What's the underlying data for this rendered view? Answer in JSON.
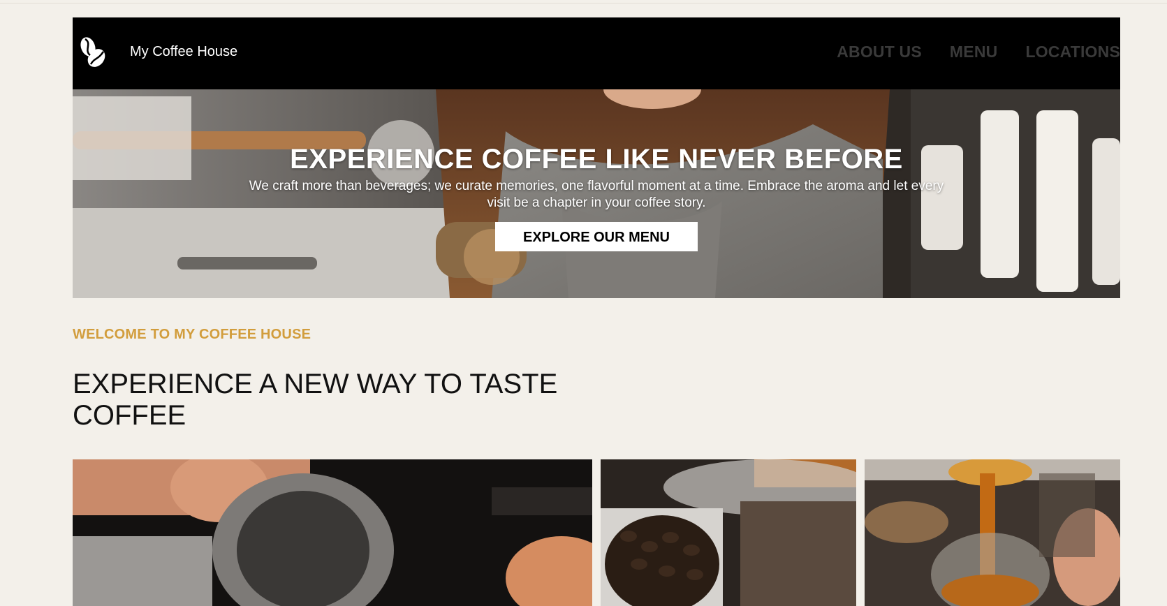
{
  "header": {
    "brand": "My Coffee House",
    "logo_icon": "coffee-beans-icon",
    "nav": [
      {
        "label": "ABOUT US"
      },
      {
        "label": "MENU"
      },
      {
        "label": "LOCATIONS"
      }
    ]
  },
  "hero": {
    "title": "EXPERIENCE COFFEE LIKE NEVER BEFORE",
    "subtitle": "We craft more than beverages; we curate memories, one flavorful moment at a time. Embrace the aroma and let every visit be a chapter in your coffee story.",
    "cta_label": "EXPLORE OUR MENU"
  },
  "intro": {
    "kicker": "WELCOME TO MY COFFEE HOUSE",
    "title": "EXPERIENCE A NEW WAY TO TASTE COFFEE"
  },
  "colors": {
    "background": "#f3f0ea",
    "header": "#000000",
    "accent": "#d29d3c",
    "nav_text": "#3a3a3a"
  }
}
